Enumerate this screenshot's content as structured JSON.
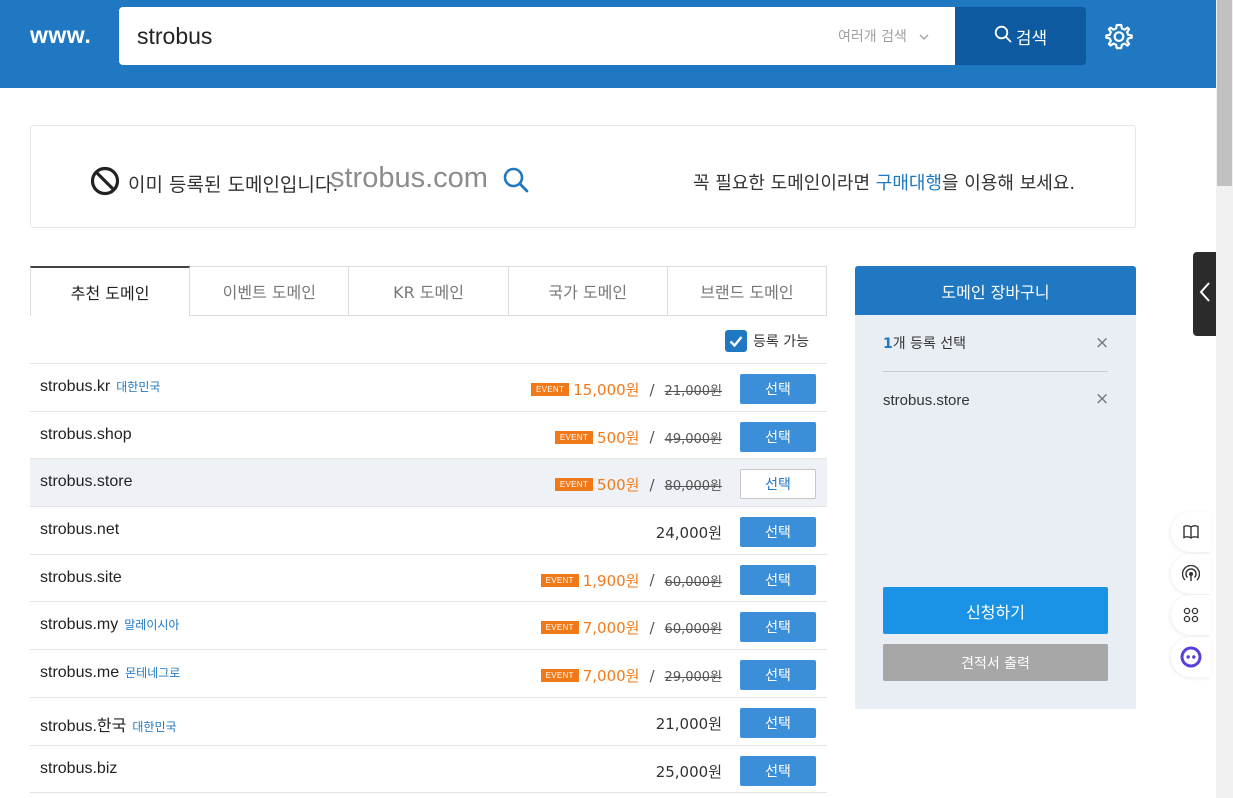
{
  "header": {
    "www_label": "www.",
    "search_value": "strobus",
    "multi_search_label": "여러개 검색",
    "search_button_label": "검색"
  },
  "notice": {
    "message": "이미 등록된 도메인입니다.",
    "domain": "strobus.com",
    "right_prefix": "꼭 필요한 도메인이라면 ",
    "right_link": "구매대행",
    "right_suffix": "을 이용해 보세요."
  },
  "tabs": [
    {
      "label": "추천 도메인"
    },
    {
      "label": "이벤트 도메인"
    },
    {
      "label": "KR 도메인"
    },
    {
      "label": "국가 도메인"
    },
    {
      "label": "브랜드 도메인"
    }
  ],
  "available_label": "등록 가능",
  "results": [
    {
      "domain": "strobus.kr",
      "country": "대한민국",
      "event": "EVENT",
      "price": "15,000원",
      "slash": "/",
      "orig": "21,000원",
      "btn": "선택"
    },
    {
      "domain": "strobus.shop",
      "country": "",
      "event": "EVENT",
      "price": "500원",
      "slash": "/",
      "orig": "49,000원",
      "btn": "선택"
    },
    {
      "domain": "strobus.store",
      "country": "",
      "event": "EVENT",
      "price": "500원",
      "slash": "/",
      "orig": "80,000원",
      "btn": "선택"
    },
    {
      "domain": "strobus.net",
      "country": "",
      "event": "",
      "price": "24,000원",
      "slash": "",
      "orig": "",
      "btn": "선택"
    },
    {
      "domain": "strobus.site",
      "country": "",
      "event": "EVENT",
      "price": "1,900원",
      "slash": "/",
      "orig": "60,000원",
      "btn": "선택"
    },
    {
      "domain": "strobus.my",
      "country": "말레이시아",
      "event": "EVENT",
      "price": "7,000원",
      "slash": "/",
      "orig": "60,000원",
      "btn": "선택"
    },
    {
      "domain": "strobus.me",
      "country": "몬테네그로",
      "event": "EVENT",
      "price": "7,000원",
      "slash": "/",
      "orig": "29,000원",
      "btn": "선택"
    },
    {
      "domain": "strobus.한국",
      "country": "대한민국",
      "event": "",
      "price": "21,000원",
      "slash": "",
      "orig": "",
      "btn": "선택"
    },
    {
      "domain": "strobus.biz",
      "country": "",
      "event": "",
      "price": "25,000원",
      "slash": "",
      "orig": "",
      "btn": "선택"
    }
  ],
  "cart": {
    "title": "도메인 장바구니",
    "count_number": "1",
    "count_suffix": "개 등록 선택",
    "item": "strobus.store",
    "close_glyph": "×",
    "apply_label": "신청하기",
    "quote_label": "견적서 출력"
  },
  "colors": {
    "header_bg": "#1f78c1",
    "search_btn_bg": "#0d5aa0",
    "event_orange": "#f07a1a",
    "select_btn_bg": "#3b8fd8",
    "apply_btn_bg": "#1a93e6",
    "quote_btn_bg": "#a7a7a7"
  }
}
